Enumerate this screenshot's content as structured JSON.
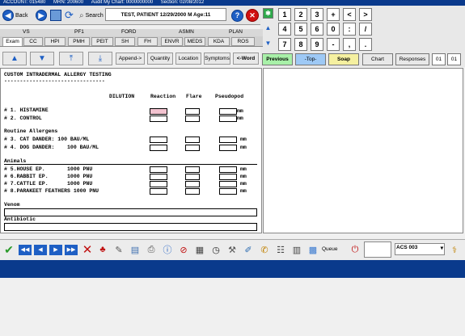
{
  "header": {
    "account": "ACCOUNT:  015480",
    "mrn": "MRN:  200600",
    "chart": "Audit My Chart: 0000000000",
    "section": "Section: 02/08/2012"
  },
  "toolbar": {
    "back_label": "Back",
    "search_label": "Search",
    "patient": "TEST, PATIENT 12/29/2000 M Age:11",
    "help_label": "?",
    "close_label": "✕"
  },
  "tabs_top": [
    "VS",
    "PF1",
    "FORD",
    "ASMN",
    "PLAN"
  ],
  "tabs_bottom": [
    "Exam",
    "CC",
    "HPI",
    "PMH",
    "PEIT",
    "SH",
    "FH",
    "ENVR",
    "MEDS",
    "KDA",
    "ROS"
  ],
  "buttons": {
    "append": "Append->",
    "quantity": "Quantity",
    "location": "Location",
    "symptoms": "Symptoms",
    "word": "<-Word"
  },
  "keypad": {
    "row1": [
      "1",
      "2",
      "3",
      "+",
      "<",
      ">"
    ],
    "row2": [
      "4",
      "5",
      "6",
      "0",
      ":",
      "/"
    ],
    "row3": [
      "7",
      "8",
      "9",
      "-",
      ",",
      "."
    ]
  },
  "right_buttons": {
    "previous": "Previous",
    "top": "-Top-",
    "soap": "Soap",
    "chart": "Chart",
    "responses": "Responses",
    "code1": "01",
    "code2": "01"
  },
  "content": {
    "title": "CUSTOM INTRADERMAL ALLERGY TESTING",
    "rule": "--------------------------------",
    "col_dilution": "DILUTION",
    "col_reaction": "Reaction",
    "col_flare": "Flare",
    "col_pseudopod": "Pseudopod",
    "rows": [
      {
        "label": "# 1. HISTAMINE",
        "unit": "mm"
      },
      {
        "label": "# 2. CONTROL",
        "unit": "mm"
      },
      {
        "label": "# 3. CAT DANDER: 100 BAU/ML",
        "unit": "mm"
      },
      {
        "label": "# 4. DOG DANDER:    100 BAU/ML",
        "unit": "mm"
      },
      {
        "label": "# 5.HOUSE EP.       1000 PNU",
        "unit": "mm"
      },
      {
        "label": "# 6.RABBIT EP.      1000 PNU",
        "unit": "mm"
      },
      {
        "label": "# 7.CATTLE EP.      1000 PNU",
        "unit": "mm"
      },
      {
        "label": "# 8.PARAKEET FEATHERS 1000 PNU",
        "unit": "mm"
      }
    ],
    "routine": "Routine Allergens",
    "animals": "Animals",
    "venom": "Venom",
    "antibiotic": "Antibiotic"
  },
  "bottom": {
    "queue": "Queue",
    "acs": "ACS   003"
  }
}
